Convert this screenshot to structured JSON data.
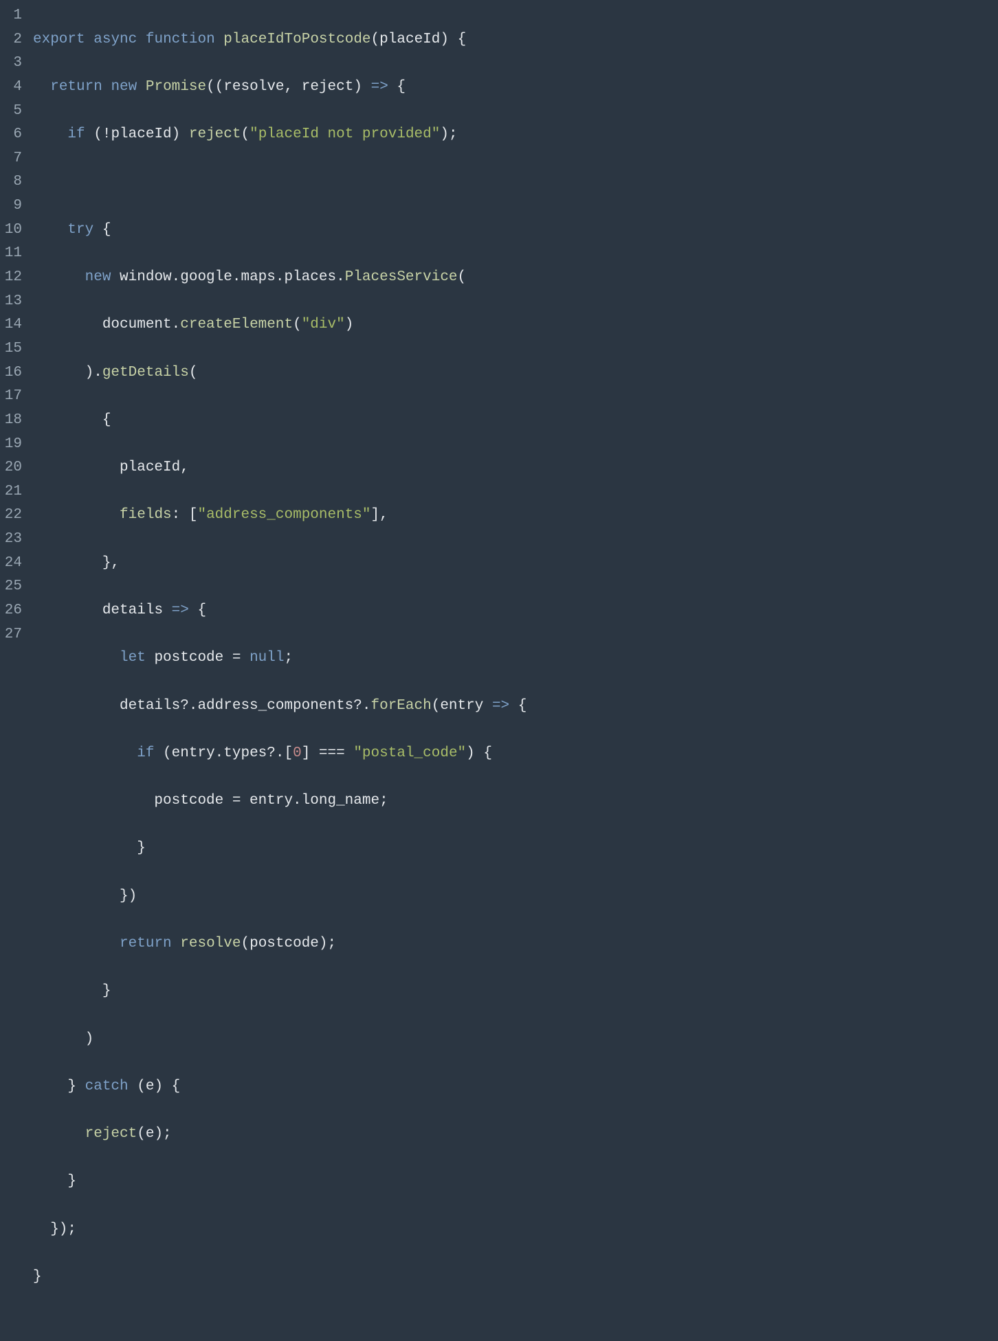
{
  "lineNumbers": [
    "1",
    "2",
    "3",
    "4",
    "5",
    "6",
    "7",
    "8",
    "9",
    "10",
    "11",
    "12",
    "13",
    "14",
    "15",
    "16",
    "17",
    "18",
    "19",
    "20",
    "21",
    "22",
    "23",
    "24",
    "25",
    "26",
    "27"
  ],
  "code": {
    "l1": {
      "t0": "export",
      "t1": "async",
      "t2": "function",
      "t3": "placeIdToPostcode",
      "t4": "(",
      "t5": "placeId",
      "t6": ") {"
    },
    "l2": {
      "t0": "  ",
      "t1": "return",
      "t2": " ",
      "t3": "new",
      "t4": " ",
      "t5": "Promise",
      "t6": "((",
      "t7": "resolve",
      "t8": ", ",
      "t9": "reject",
      "t10": ") ",
      "t11": "=>",
      "t12": " {"
    },
    "l3": {
      "t0": "    ",
      "t1": "if",
      "t2": " (!placeId) ",
      "t3": "reject",
      "t4": "(",
      "t5": "\"placeId not provided\"",
      "t6": ");"
    },
    "l4": {
      "t0": ""
    },
    "l5": {
      "t0": "    ",
      "t1": "try",
      "t2": " {"
    },
    "l6": {
      "t0": "      ",
      "t1": "new",
      "t2": " window.google.maps.places.",
      "t3": "PlacesService",
      "t4": "("
    },
    "l7": {
      "t0": "        document.",
      "t1": "createElement",
      "t2": "(",
      "t3": "\"div\"",
      "t4": ")"
    },
    "l8": {
      "t0": "      ).",
      "t1": "getDetails",
      "t2": "("
    },
    "l9": {
      "t0": "        {"
    },
    "l10": {
      "t0": "          placeId,"
    },
    "l11": {
      "t0": "          ",
      "t1": "fields",
      "t2": ": [",
      "t3": "\"address_components\"",
      "t4": "],"
    },
    "l12": {
      "t0": "        },"
    },
    "l13": {
      "t0": "        ",
      "t1": "details",
      "t2": " ",
      "t3": "=>",
      "t4": " {"
    },
    "l14": {
      "t0": "          ",
      "t1": "let",
      "t2": " postcode = ",
      "t3": "null",
      "t4": ";"
    },
    "l15": {
      "t0": "          details?.address_components?.",
      "t1": "forEach",
      "t2": "(",
      "t3": "entry",
      "t4": " ",
      "t5": "=>",
      "t6": " {"
    },
    "l16": {
      "t0": "            ",
      "t1": "if",
      "t2": " (entry.types?.[",
      "t3": "0",
      "t4": "] === ",
      "t5": "\"postal_code\"",
      "t6": ") {"
    },
    "l17": {
      "t0": "              postcode = entry.long_name;"
    },
    "l18": {
      "t0": "            }"
    },
    "l19": {
      "t0": "          })"
    },
    "l20": {
      "t0": "          ",
      "t1": "return",
      "t2": " ",
      "t3": "resolve",
      "t4": "(postcode);"
    },
    "l21": {
      "t0": "        }"
    },
    "l22": {
      "t0": "      )"
    },
    "l23": {
      "t0": "    } ",
      "t1": "catch",
      "t2": " (e) {"
    },
    "l24": {
      "t0": "      ",
      "t1": "reject",
      "t2": "(e);"
    },
    "l25": {
      "t0": "    }"
    },
    "l26": {
      "t0": "  });"
    },
    "l27": {
      "t0": "}"
    }
  }
}
